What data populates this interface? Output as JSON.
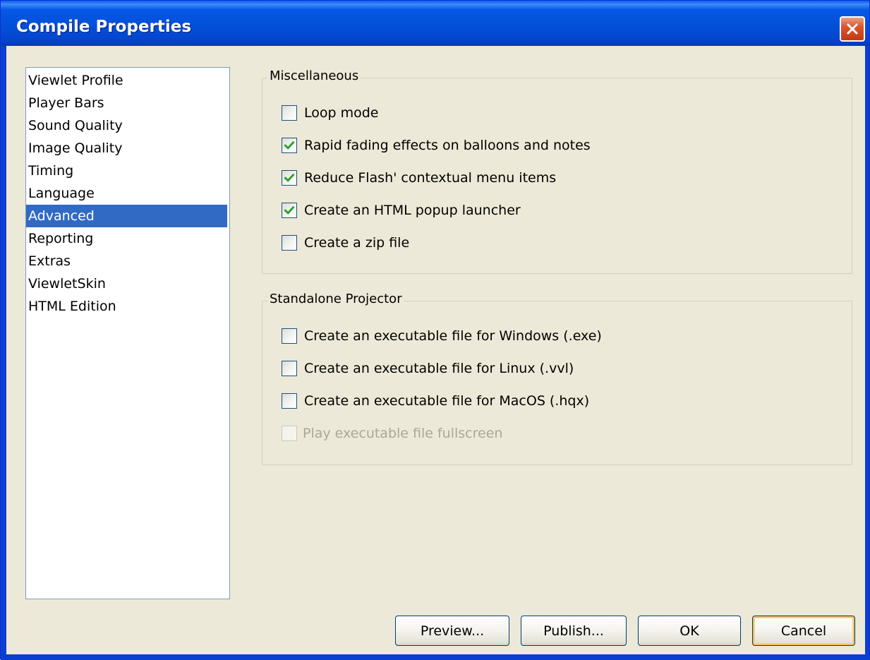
{
  "window": {
    "title": "Compile Properties",
    "close_label": "✕"
  },
  "categories": [
    {
      "label": "Viewlet Profile",
      "selected": false
    },
    {
      "label": "Player Bars",
      "selected": false
    },
    {
      "label": "Sound Quality",
      "selected": false
    },
    {
      "label": "Image Quality",
      "selected": false
    },
    {
      "label": "Timing",
      "selected": false
    },
    {
      "label": "Language",
      "selected": false
    },
    {
      "label": "Advanced",
      "selected": true
    },
    {
      "label": "Reporting",
      "selected": false
    },
    {
      "label": "Extras",
      "selected": false
    },
    {
      "label": "ViewletSkin",
      "selected": false
    },
    {
      "label": "HTML Edition",
      "selected": false
    }
  ],
  "miscellaneous": {
    "title": "Miscellaneous",
    "options": [
      {
        "label": "Loop mode",
        "checked": false
      },
      {
        "label": "Rapid fading effects on balloons and notes",
        "checked": true
      },
      {
        "label": "Reduce Flash' contextual menu items",
        "checked": true
      },
      {
        "label": "Create an HTML popup launcher",
        "checked": true
      },
      {
        "label": "Create a zip file",
        "checked": false
      }
    ]
  },
  "standalone": {
    "title": "Standalone Projector",
    "options": [
      {
        "label": "Create an executable file for Windows (.exe)",
        "checked": false,
        "enabled": true
      },
      {
        "label": "Create an executable file for Linux (.vvl)",
        "checked": false,
        "enabled": true
      },
      {
        "label": "Create an executable file for MacOS (.hqx)",
        "checked": false,
        "enabled": true
      },
      {
        "label": "Play executable file fullscreen",
        "checked": false,
        "enabled": false
      }
    ]
  },
  "buttons": {
    "preview": "Preview...",
    "publish": "Publish...",
    "ok": "OK",
    "cancel": "Cancel"
  },
  "colors": {
    "titlebar": "#0350d8",
    "selection": "#316ac5",
    "checkmark": "#21a121",
    "dialog_bg": "#ece9d8"
  }
}
